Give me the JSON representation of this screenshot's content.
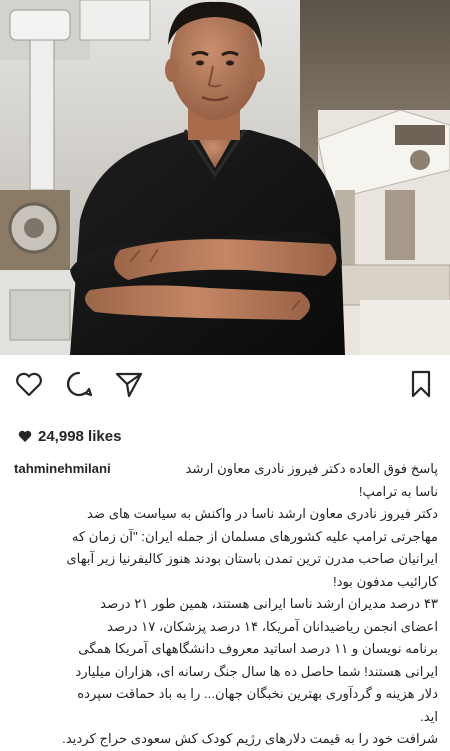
{
  "post": {
    "likes_count": "24,998 likes",
    "username": "tahminehmilani",
    "caption_lines": [
      "پاسخ فوق العاده دکتر فیروز نادری معاون ارشد",
      "ناسا به ترامپ!",
      "دکتر فیروز نادری معاون ارشد ناسا در واکنش به سیاست های ضد",
      "مهاجرتی ترامپ علیه کشورهای مسلمان از جمله ایران: \"آن زمان که",
      "ایرانیان صاحب مدرن ترین تمدن باستان بودند هنوز کالیفرنیا زیر آبهای",
      "کارائیب مدفون بود!",
      "۴۳ درصد مدیران ارشد ناسا ایرانی هستند، همین طور ۲۱ درصد",
      "اعضای انجمن ریاضیدانان آمریکا، ۱۴ درصد پزشکان، ۱۷ درصد",
      "برنامه نویسان و ۱۱ درصد اساتید معروف دانشگاههای آمریکا همگی",
      "ایرانی هستند!  شما حاصل ده ها سال جنگ رسانه ای، هزاران میلیارد",
      "دلار هزینه و گردآوری بهترین نخبگان جهان... را به باد حماقت سپرده",
      "اید.",
      "شرافت خود را به قیمت دلارهای رژیم کودک کش سعودی حراج کردید."
    ]
  },
  "icons": {
    "like": "heart-outline-icon",
    "comment": "speech-bubble-icon",
    "share": "paper-plane-icon",
    "save": "bookmark-icon",
    "likes_heart": "heart-filled-icon"
  },
  "colors": {
    "text": "#262626",
    "background": "#ffffff"
  }
}
